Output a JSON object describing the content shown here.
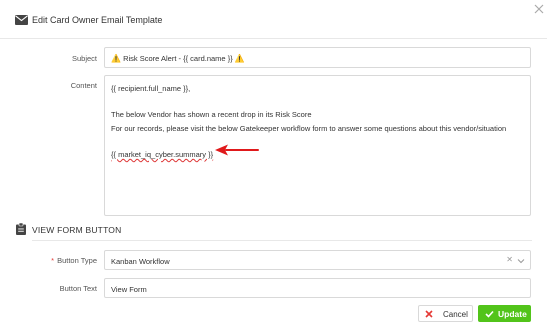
{
  "modal": {
    "title": "Edit Card Owner Email Template"
  },
  "form": {
    "subject_label": "Subject",
    "subject_value": "Risk Score Alert - {{ card.name }}",
    "content_label": "Content",
    "content_lines": [
      "{{ recipient.full_name }},",
      "",
      "The below Vendor has shown a recent drop in its Risk Score",
      "For our records, please visit the below Gatekeeper workflow form to answer some questions about this vendor/situation",
      "",
      "{{ market_iq_cyber.summary }}"
    ]
  },
  "view_form_section": {
    "title": "VIEW FORM BUTTON",
    "button_type_label": "Button Type",
    "button_type_required": "*",
    "button_type_value": "Kanban Workflow",
    "button_text_label": "Button Text",
    "button_text_value": "View Form"
  },
  "footer": {
    "cancel_label": "Cancel",
    "update_label": "Update"
  },
  "colors": {
    "accent_green": "#52c41a",
    "annotation_red": "#e0191b",
    "required_red": "#e53935"
  }
}
